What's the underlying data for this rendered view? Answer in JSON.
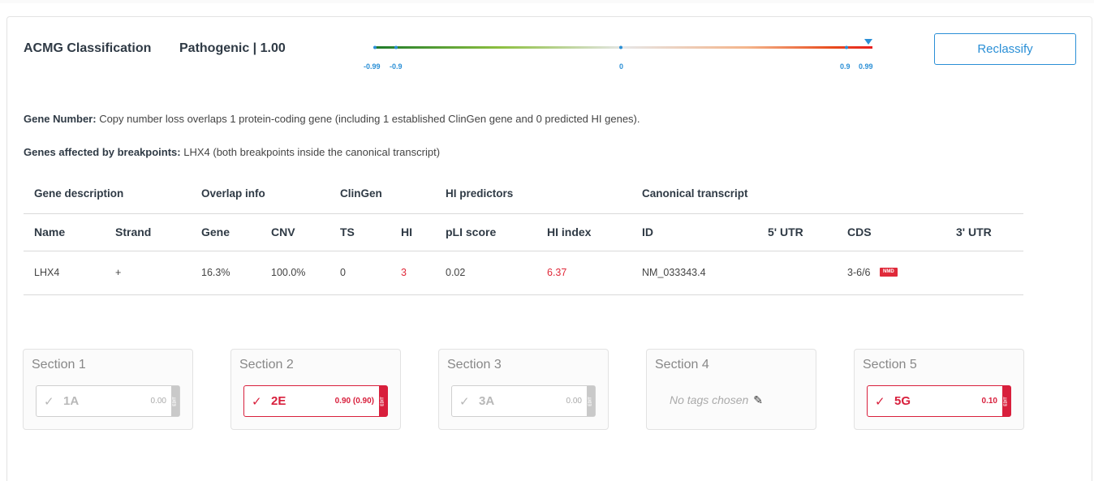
{
  "acmg": {
    "label": "ACMG Classification",
    "value": "Pathogenic | 1.00",
    "reclassify_label": "Reclassify",
    "scale_ticks": [
      "-0.99",
      "-0.9",
      "0",
      "0.9",
      "0.99"
    ],
    "score": 1.0
  },
  "summary": {
    "gene_number_label": "Gene Number:",
    "gene_number_text": " Copy number loss overlaps 1 protein-coding gene (including 1 established ClinGen gene and 0 predicted HI genes).",
    "breakpoints_label": "Genes affected by breakpoints:",
    "breakpoints_text": " LHX4 (both breakpoints inside the canonical transcript)"
  },
  "table": {
    "groups": [
      "Gene description",
      "Overlap info",
      "ClinGen",
      "HI predictors",
      "Canonical transcript"
    ],
    "headers": [
      "Name",
      "Strand",
      "Gene",
      "CNV",
      "TS",
      "HI",
      "pLI score",
      "HI index",
      "ID",
      "5' UTR",
      "CDS",
      "3' UTR"
    ],
    "rows": [
      {
        "name": "LHX4",
        "strand": "+",
        "gene": "16.3%",
        "cnv": "100.0%",
        "ts": "0",
        "hi": "3",
        "pli": "0.02",
        "hi_index": "6.37",
        "id": "NM_033343.4",
        "utr5": "",
        "cds": "3-6/6",
        "cds_badge": "NMD",
        "utr3": ""
      }
    ]
  },
  "sections": [
    {
      "title": "Section 1",
      "tag": "1A",
      "score": "0.00",
      "active": false
    },
    {
      "title": "Section 2",
      "tag": "2E",
      "score": "0.90 (0.90)",
      "active": true
    },
    {
      "title": "Section 3",
      "tag": "3A",
      "score": "0.00",
      "active": false
    },
    {
      "title": "Section 4",
      "no_tags": "No tags chosen"
    },
    {
      "title": "Section 5",
      "tag": "5G",
      "score": "0.10",
      "active": true
    }
  ],
  "edit_label": "EDIT",
  "colors": {
    "accent": "#2a8fd6",
    "pathogenic_red": "#e02a3a",
    "benign_green": "#2e8b2e"
  },
  "icons": {
    "check": "check-icon",
    "pencil": "pencil-icon",
    "marker": "triangle-marker-icon"
  }
}
